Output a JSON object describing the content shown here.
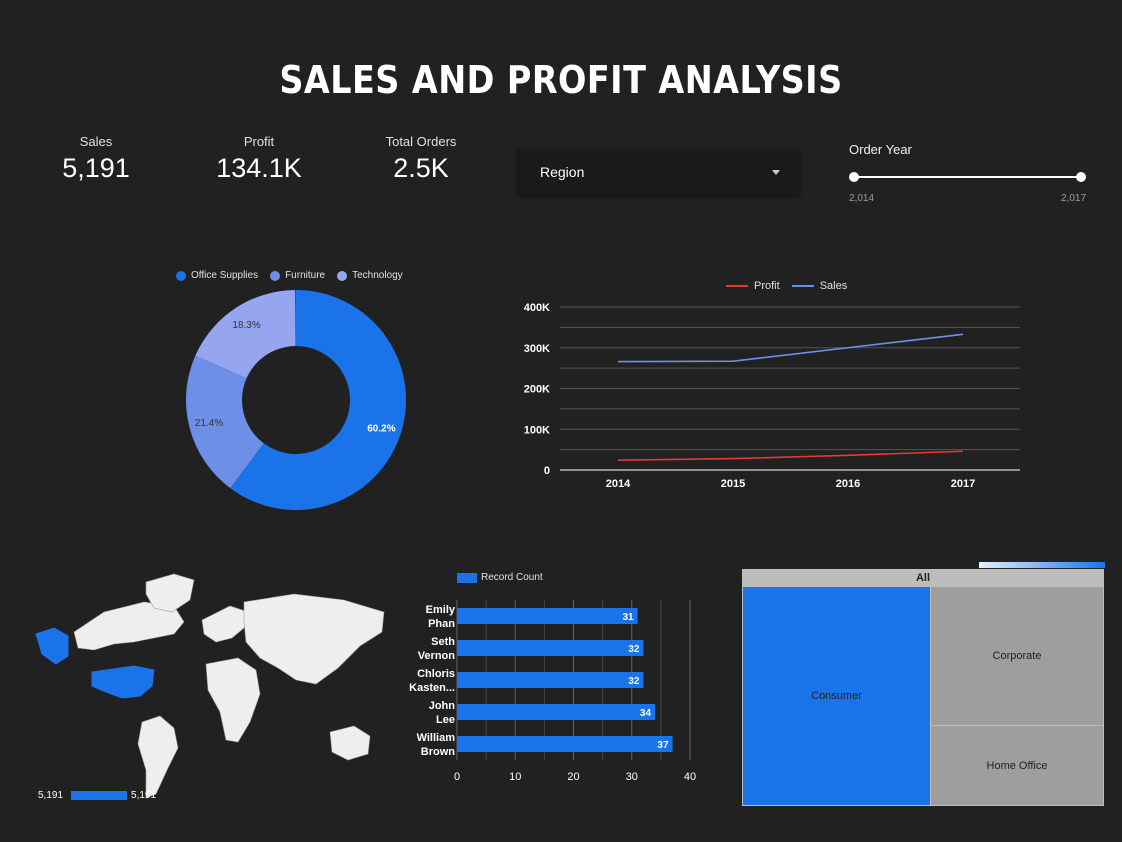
{
  "title": "SALES AND PROFIT ANALYSIS",
  "kpis": [
    {
      "label": "Sales",
      "value": "5,191"
    },
    {
      "label": "Profit",
      "value": "134.1K"
    },
    {
      "label": "Total Orders",
      "value": "2.5K"
    }
  ],
  "region_filter": {
    "label": "Region"
  },
  "year_slider": {
    "label": "Order Year",
    "min_label": "2,014",
    "max_label": "2,017",
    "min": 2014,
    "max": 2017
  },
  "colors": {
    "background": "#212121",
    "primary": "#1a73e8",
    "secondary": "#6d8fe8",
    "tertiary": "#95a5f0",
    "profit": "#e53935",
    "sales": "#6d8fe8"
  },
  "chart_data": [
    {
      "type": "pie",
      "variant": "donut",
      "legend": [
        "Office Supplies",
        "Furniture",
        "Technology"
      ],
      "slices": [
        {
          "name": "Office Supplies",
          "percent": 60.2,
          "label": "60.2%",
          "color": "#1a73e8"
        },
        {
          "name": "Furniture",
          "percent": 21.4,
          "label": "21.4%",
          "color": "#6d8fe8"
        },
        {
          "name": "Technology",
          "percent": 18.3,
          "label": "18.3%",
          "color": "#95a5f0"
        }
      ],
      "legend_position": "top"
    },
    {
      "type": "line",
      "categories": [
        "2014",
        "2015",
        "2016",
        "2017"
      ],
      "series": [
        {
          "name": "Profit",
          "values": [
            24000,
            28000,
            36000,
            46000
          ],
          "color": "#e53935"
        },
        {
          "name": "Sales",
          "values": [
            266000,
            267000,
            300000,
            333000
          ],
          "color": "#6d8fe8"
        }
      ],
      "y_ticks": [
        "0",
        "100K",
        "200K",
        "300K",
        "400K"
      ],
      "ylim": [
        0,
        400000
      ],
      "grid": true,
      "legend_position": "top"
    },
    {
      "type": "bar",
      "orientation": "horizontal",
      "legend": "Record Count",
      "categories": [
        [
          "Emily",
          "Phan"
        ],
        [
          "Seth",
          "Vernon"
        ],
        [
          "Chloris",
          "Kasten..."
        ],
        [
          "John",
          "Lee"
        ],
        [
          "William",
          "Brown"
        ]
      ],
      "values": [
        31,
        32,
        32,
        34,
        37
      ],
      "x_ticks": [
        "0",
        "10",
        "20",
        "30",
        "40"
      ],
      "xlim": [
        0,
        40
      ],
      "color": "#1a73e8",
      "legend_position": "top-left"
    },
    {
      "type": "treemap",
      "root": "All",
      "nodes": [
        {
          "name": "Consumer",
          "color": "#1a73e8"
        },
        {
          "name": "Corporate",
          "color": "#9e9e9e"
        },
        {
          "name": "Home Office",
          "color": "#9e9e9e"
        }
      ]
    }
  ],
  "map": {
    "legend_min": "5,191",
    "legend_max": "5,191",
    "highlight": "United States"
  }
}
